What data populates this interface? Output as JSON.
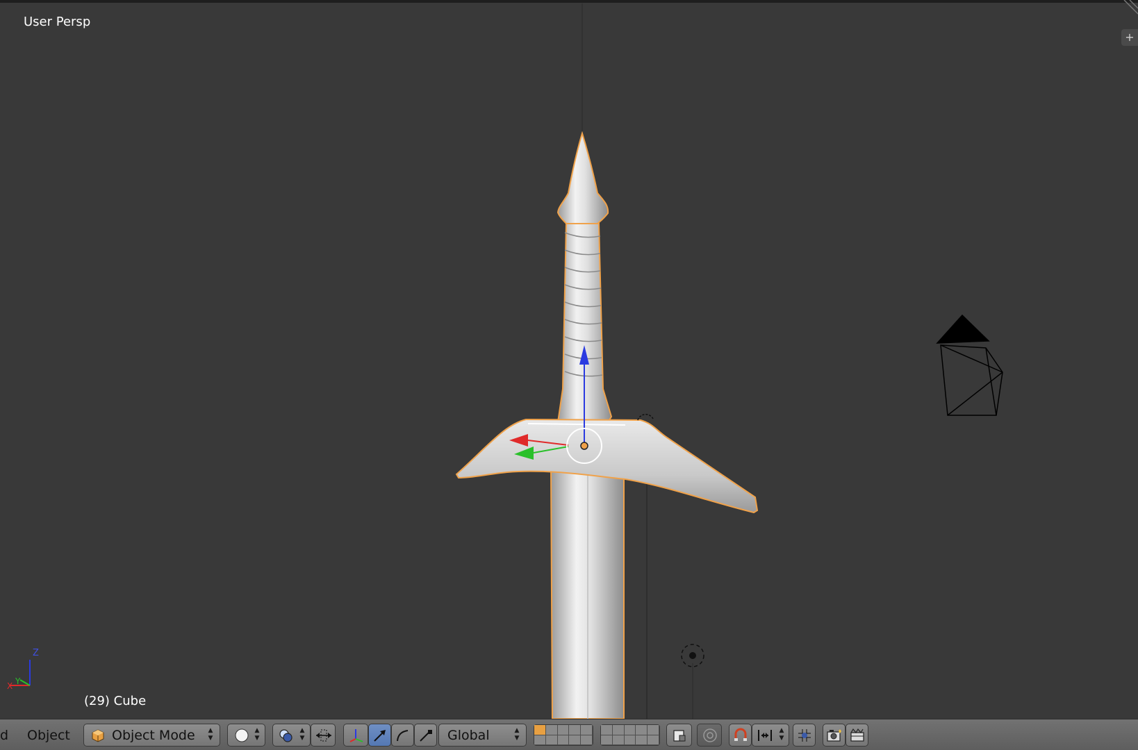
{
  "viewport": {
    "view_label": "User Persp",
    "object_info": "(29) Cube",
    "axis_labels": {
      "x": "X",
      "y": "Y",
      "z": "Z"
    }
  },
  "header": {
    "cut_menu_label": "d",
    "object_menu_label": "Object",
    "mode_label": "Object Mode",
    "orientation_label": "Global",
    "updown_up": "▲",
    "updown_down": "▼",
    "toolshelf_toggle": "+"
  },
  "colors": {
    "viewport_bg": "#393939",
    "header_bg": "#6a6a6a",
    "selection_outline": "#f0a24a",
    "axis_x": "#e02a2a",
    "axis_y": "#2ac02a",
    "axis_z": "#2a3ae0",
    "active_button": "#5a7fbc"
  },
  "icons": [
    "object-mode-cube-icon",
    "viewport-shading-solid-icon",
    "pivot-point-icon",
    "manipulator-toggle-icon",
    "translate-manipulator-icon",
    "rotate-manipulator-icon",
    "scale-manipulator-icon",
    "layer-lock-icon",
    "proportional-edit-icon",
    "snap-magnet-icon",
    "snap-element-icon",
    "snap-target-icon",
    "opengl-render-icon",
    "opengl-animation-icon",
    "camera-object",
    "3d-cursor"
  ]
}
